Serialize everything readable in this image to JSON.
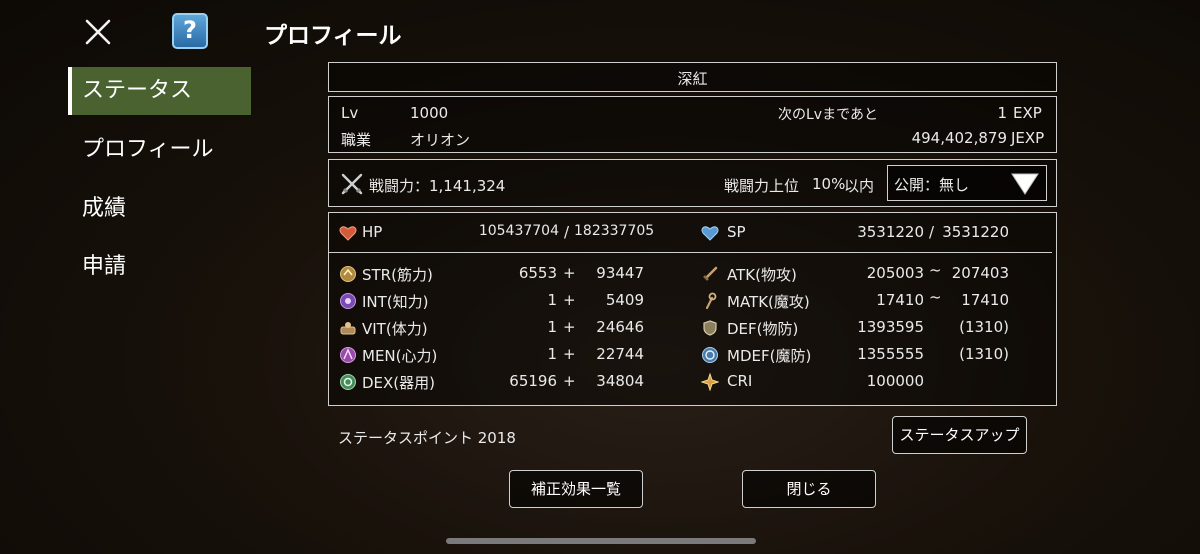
{
  "header": {
    "title": "プロフィール",
    "help_label": "?"
  },
  "sidebar": {
    "items": [
      {
        "label": "ステータス",
        "active": true
      },
      {
        "label": "プロフィール",
        "active": false
      },
      {
        "label": "成績",
        "active": false
      },
      {
        "label": "申請",
        "active": false
      }
    ]
  },
  "character": {
    "name": "深紅"
  },
  "level": {
    "lv_label": "Lv",
    "lv_value": "1000",
    "job_label": "職業",
    "job_value": "オリオン",
    "next_label": "次のLvまであと",
    "exp_value": "1",
    "exp_unit": "EXP",
    "jexp_value": "494,402,879",
    "jexp_unit": "JEXP"
  },
  "power": {
    "label": "戦闘力：1,141,324",
    "rank_label": "戦闘力上位",
    "rank_value": "10%",
    "rank_suffix": "以内",
    "visibility": "公開：無し"
  },
  "vitals": {
    "hp_label": "HP",
    "hp_current": "105437704",
    "hp_sep": "/",
    "hp_max": "182337705",
    "sp_label": "SP",
    "sp_current": "3531220",
    "sp_sep": "/",
    "sp_max": "3531220"
  },
  "stats": [
    {
      "name": "STR(筋力)",
      "base": "6553",
      "plus": "+",
      "bonus": "93447",
      "icon": "str-icon"
    },
    {
      "name": "INT(知力)",
      "base": "1",
      "plus": "+",
      "bonus": "5409",
      "icon": "int-icon"
    },
    {
      "name": "VIT(体力)",
      "base": "1",
      "plus": "+",
      "bonus": "24646",
      "icon": "vit-icon"
    },
    {
      "name": "MEN(心力)",
      "base": "1",
      "plus": "+",
      "bonus": "22744",
      "icon": "men-icon"
    },
    {
      "name": "DEX(器用)",
      "base": "65196",
      "plus": "+",
      "bonus": "34804",
      "icon": "dex-icon"
    }
  ],
  "combat": [
    {
      "name": "ATK(物攻)",
      "v1": "205003",
      "sep": "~",
      "v2": "207403",
      "icon": "atk-icon"
    },
    {
      "name": "MATK(魔攻)",
      "v1": "17410",
      "sep": "~",
      "v2": "17410",
      "icon": "matk-icon"
    },
    {
      "name": "DEF(物防)",
      "v1": "1393595",
      "sep": "",
      "v2": "(1310)",
      "icon": "def-icon"
    },
    {
      "name": "MDEF(魔防)",
      "v1": "1355555",
      "sep": "",
      "v2": "(1310)",
      "icon": "mdef-icon"
    },
    {
      "name": "CRI",
      "v1": "100000",
      "sep": "",
      "v2": "",
      "icon": "cri-icon"
    }
  ],
  "status_points": "ステータスポイント 2018",
  "buttons": {
    "status_up": "ステータスアップ",
    "effects_list": "補正効果一覧",
    "close": "閉じる"
  },
  "colors": {
    "active_tab": "#4a6230",
    "panel_border": "#cfcfcf"
  }
}
